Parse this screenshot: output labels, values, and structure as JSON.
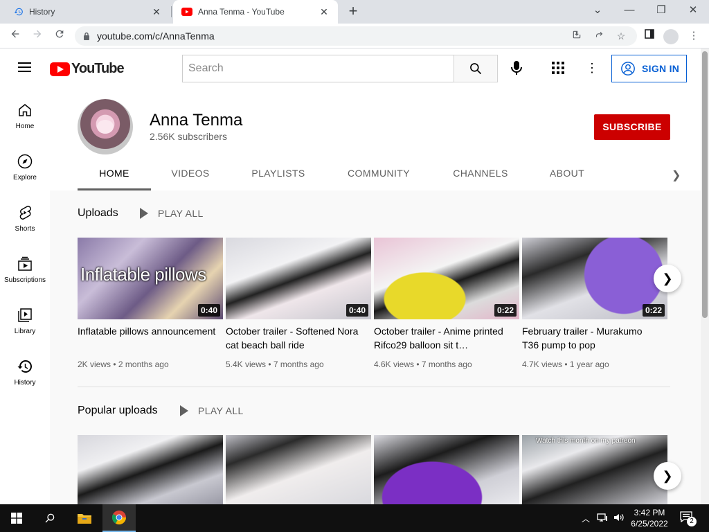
{
  "browser": {
    "tabs": [
      {
        "title": "History",
        "icon": "history-icon",
        "active": false
      },
      {
        "title": "Anna Tenma - YouTube",
        "icon": "youtube-icon",
        "active": true
      }
    ],
    "new_tab_label": "+",
    "url": "youtube.com/c/AnnaTenma"
  },
  "masthead": {
    "logo_text": "YouTube",
    "search_placeholder": "Search",
    "sign_in_label": "SIGN IN"
  },
  "guide": {
    "items": [
      {
        "label": "Home",
        "icon": "home-icon"
      },
      {
        "label": "Explore",
        "icon": "compass-icon"
      },
      {
        "label": "Shorts",
        "icon": "shorts-icon"
      },
      {
        "label": "Subscriptions",
        "icon": "subscriptions-icon"
      },
      {
        "label": "Library",
        "icon": "library-icon"
      },
      {
        "label": "History",
        "icon": "history-icon"
      }
    ]
  },
  "channel": {
    "name": "Anna Tenma",
    "subscribers": "2.56K subscribers",
    "subscribe_label": "SUBSCRIBE",
    "tabs": [
      "HOME",
      "VIDEOS",
      "PLAYLISTS",
      "COMMUNITY",
      "CHANNELS",
      "ABOUT"
    ],
    "active_tab": "HOME"
  },
  "shelves": [
    {
      "title": "Uploads",
      "play_all_label": "PLAY ALL",
      "videos": [
        {
          "title": "Inflatable pillows announcement",
          "thumb_text": "Inflatable pillows",
          "duration": "0:40",
          "views": "2K views",
          "age": "2 months ago"
        },
        {
          "title": "October trailer - Softened Nora cat beach ball ride",
          "duration": "0:40",
          "views": "5.4K views",
          "age": "7 months ago"
        },
        {
          "title": "October trailer - Anime printed Rifco29 balloon sit t…",
          "duration": "0:22",
          "views": "4.6K views",
          "age": "7 months ago"
        },
        {
          "title": "February trailer - Murakumo T36 pump to pop",
          "duration": "0:22",
          "views": "4.7K views",
          "age": "1 year ago"
        }
      ]
    },
    {
      "title": "Popular uploads",
      "play_all_label": "PLAY ALL",
      "videos": [
        {
          "thumb_text": ""
        },
        {
          "thumb_text": ""
        },
        {
          "thumb_text": ""
        },
        {
          "thumb_text": "Watch this month on my patreon"
        }
      ]
    }
  ],
  "taskbar": {
    "time": "3:42 PM",
    "date": "6/25/2022",
    "notification_count": "2"
  },
  "colors": {
    "youtube_red": "#ff0000",
    "subscribe_red": "#cc0000",
    "signin_blue": "#065fd4",
    "taskbar_bg": "#101010"
  }
}
